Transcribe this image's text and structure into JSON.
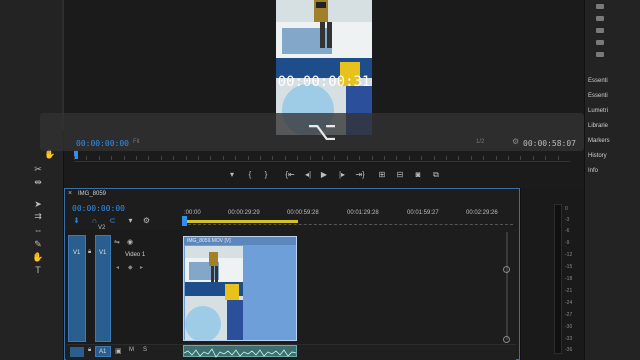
{
  "program": {
    "overlay_timecode": "00:00:00:31",
    "current_timecode": "00:00:00:00",
    "fit": "Fit",
    "resolution": "1/2",
    "duration": "00:00:58:07",
    "key_glyph": "⌥"
  },
  "right_panel": {
    "items": [
      "Essenti",
      "Essenti",
      "Lumetri",
      "Librarie",
      "Markers",
      "History",
      "Info"
    ]
  },
  "timeline": {
    "sequence_name": "IMG_8059",
    "timecode": "00:00:00:00",
    "ruler_times": [
      ":00:00",
      "00:00:29:29",
      "00:00:59:28",
      "00:01:29:28",
      "00:01:59:27",
      "00:02:29:26"
    ],
    "v2_label": "V2",
    "v1_source": "V1",
    "v1_target": "V1",
    "video3_label": "Video 1",
    "clip_name": "IMG_8059.MOV [V]",
    "a1_label": "A1",
    "audio_m": "M",
    "audio_s": "S"
  },
  "meter": {
    "labels": [
      "0",
      "-3",
      "-6",
      "-9",
      "-12",
      "-15",
      "-18",
      "-21",
      "-24",
      "-27",
      "-30",
      "-33",
      "-36"
    ]
  },
  "colors": {
    "accent_blue": "#2f8ef0",
    "track_blue": "#2a5e8e",
    "clip_blue": "#6f9fd8",
    "work_area_yellow": "#d4c12a"
  }
}
